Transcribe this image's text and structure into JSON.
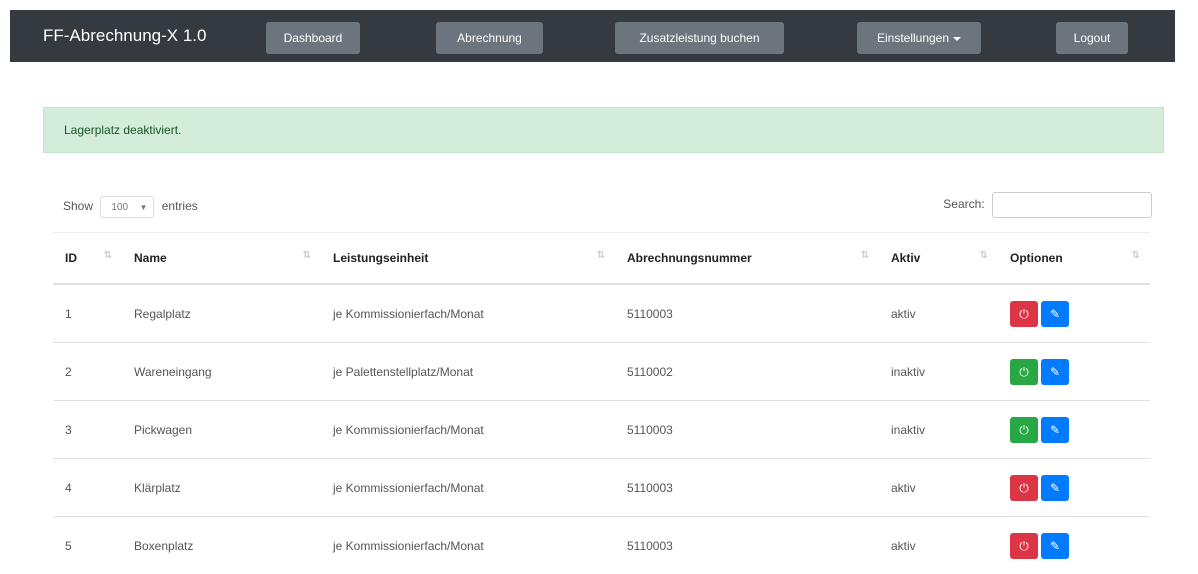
{
  "app": {
    "title": "FF-Abrechnung-X 1.0"
  },
  "nav": {
    "items": [
      {
        "label": "Dashboard"
      },
      {
        "label": "Abrechnung"
      },
      {
        "label": "Zusatzleistung buchen"
      },
      {
        "label": "Einstellungen"
      },
      {
        "label": "Logout"
      }
    ]
  },
  "alert": {
    "message": "Lagerplatz deaktiviert."
  },
  "table_controls": {
    "show_label": "Show",
    "entries_value": "100",
    "entries_label": "entries",
    "search_label": "Search:",
    "search_value": ""
  },
  "table": {
    "columns": [
      "ID",
      "Name",
      "Leistungseinheit",
      "Abrechnungsnummer",
      "Aktiv",
      "Optionen"
    ],
    "rows": [
      {
        "id": "1",
        "name": "Regalplatz",
        "einheit": "je Kommissionierfach/Monat",
        "nummer": "5110003",
        "aktiv": "aktiv",
        "toggle_color": "#dc3545"
      },
      {
        "id": "2",
        "name": "Wareneingang",
        "einheit": "je Palettenstellplatz/Monat",
        "nummer": "5110002",
        "aktiv": "inaktiv",
        "toggle_color": "#28a745"
      },
      {
        "id": "3",
        "name": "Pickwagen",
        "einheit": "je Kommissionierfach/Monat",
        "nummer": "5110003",
        "aktiv": "inaktiv",
        "toggle_color": "#28a745"
      },
      {
        "id": "4",
        "name": "Klärplatz",
        "einheit": "je Kommissionierfach/Monat",
        "nummer": "5110003",
        "aktiv": "aktiv",
        "toggle_color": "#dc3545"
      },
      {
        "id": "5",
        "name": "Boxenplatz",
        "einheit": "je Kommissionierfach/Monat",
        "nummer": "5110003",
        "aktiv": "aktiv",
        "toggle_color": "#dc3545"
      }
    ]
  },
  "icons": {
    "toggle": "power-icon",
    "edit": "edit-icon",
    "sort": "sort-icon"
  }
}
